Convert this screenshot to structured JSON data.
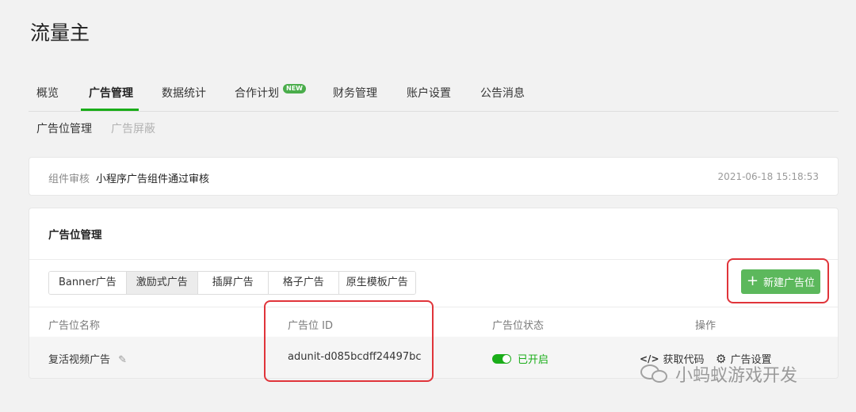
{
  "app": {
    "title": "流量主"
  },
  "main_nav": {
    "items": [
      {
        "label": "概览"
      },
      {
        "label": "广告管理",
        "active": true
      },
      {
        "label": "数据统计"
      },
      {
        "label": "合作计划",
        "badge": "NEW"
      },
      {
        "label": "财务管理"
      },
      {
        "label": "账户设置"
      },
      {
        "label": "公告消息"
      }
    ]
  },
  "sub_nav": {
    "items": [
      {
        "label": "广告位管理",
        "active": true
      },
      {
        "label": "广告屏蔽"
      }
    ]
  },
  "review": {
    "label": "组件审核",
    "text": "小程序广告组件通过审核",
    "time": "2021-06-18 15:18:53"
  },
  "ad_panel": {
    "title": "广告位管理",
    "tabs": [
      {
        "label": "Banner广告"
      },
      {
        "label": "激励式广告",
        "active": true
      },
      {
        "label": "插屏广告"
      },
      {
        "label": "格子广告"
      },
      {
        "label": "原生模板广告"
      }
    ],
    "new_button": {
      "icon": "plus-icon",
      "label": "新建广告位"
    },
    "table": {
      "headers": [
        "广告位名称",
        "广告位 ID",
        "广告位状态",
        "操作"
      ],
      "rows": [
        {
          "name": "复活视频广告",
          "id": "adunit-d085bcdff24497bc",
          "status": "已开启",
          "actions": [
            {
              "icon": "code-icon",
              "label": "获取代码"
            },
            {
              "icon": "gear-icon",
              "label": "广告设置"
            }
          ]
        }
      ]
    }
  },
  "watermark": {
    "text": "小蚂蚁游戏开发"
  },
  "colors": {
    "accent": "#1aad19",
    "button": "#5cb85c",
    "highlight": "#e0343a",
    "badge": "#4aad4b"
  }
}
